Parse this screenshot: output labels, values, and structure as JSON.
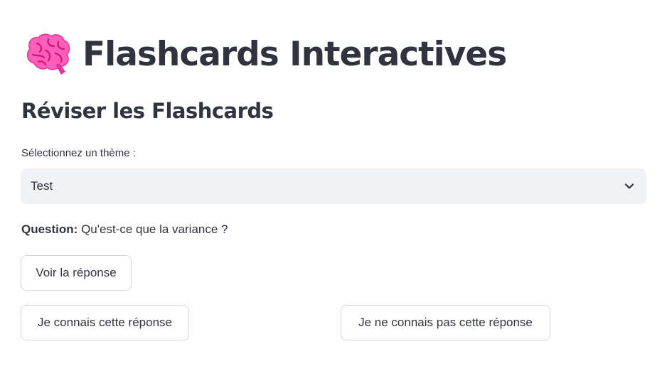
{
  "header": {
    "icon": "brain-icon",
    "title": "Flashcards Interactives"
  },
  "section": {
    "title": "Réviser les Flashcards"
  },
  "theme_select": {
    "label": "Sélectionnez un thème :",
    "value": "Test",
    "icon": "chevron-down-icon"
  },
  "question": {
    "label": "Question:",
    "text": " Qu'est-ce que la variance ?"
  },
  "buttons": {
    "show_answer": "Voir la réponse",
    "know": "Je connais cette réponse",
    "dont_know": "Je ne connais pas cette réponse"
  },
  "colors": {
    "text": "#31333f",
    "select_bg": "#f0f2f6",
    "button_border": "#d6d6d9",
    "brain_pink": "#ff4fb1"
  }
}
